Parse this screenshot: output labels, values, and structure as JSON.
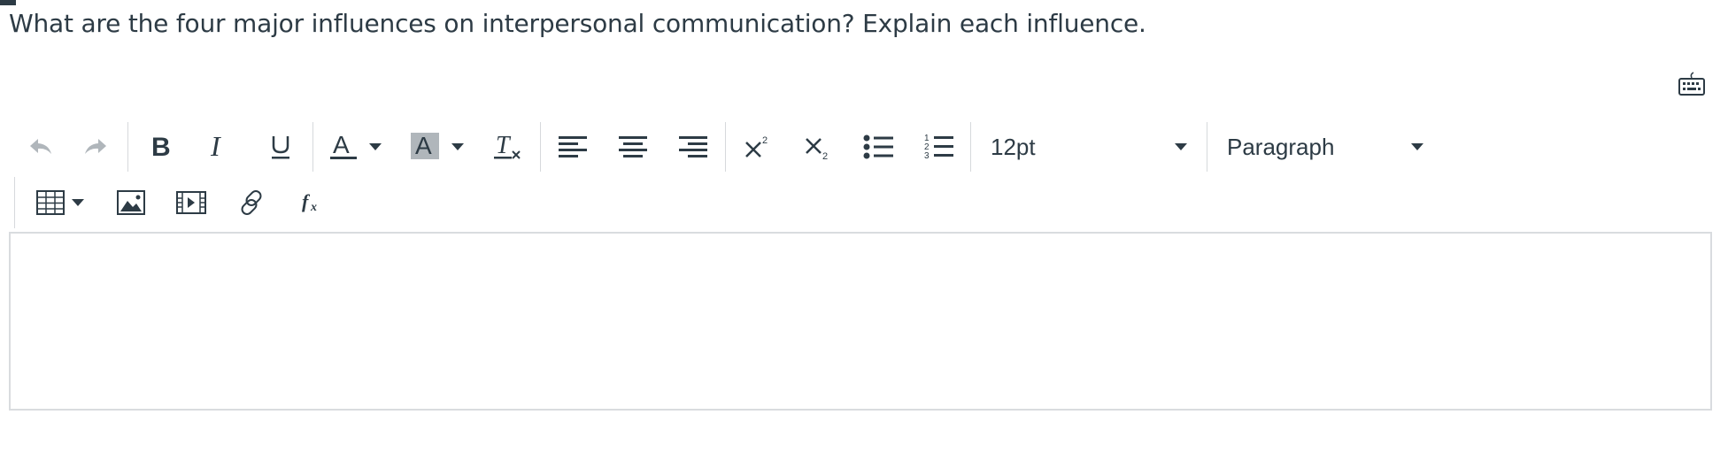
{
  "question": {
    "text": "What are the four major influences on interpersonal communication? Explain each influence."
  },
  "toolbar": {
    "font_size": "12pt",
    "block_format": "Paragraph",
    "icons": [
      "undo-icon",
      "redo-icon",
      "bold-icon",
      "italic-icon",
      "underline-icon",
      "text-color-icon",
      "highlight-color-icon",
      "clear-formatting-icon",
      "align-left-icon",
      "align-center-icon",
      "align-right-icon",
      "superscript-icon",
      "subscript-icon",
      "bullet-list-icon",
      "numbered-list-icon",
      "table-icon",
      "image-icon",
      "media-icon",
      "link-icon",
      "math-icon",
      "keyboard-icon"
    ]
  },
  "editor": {
    "content": ""
  },
  "colors": {
    "text": "#2d3b45",
    "disabled": "#b0b6bb",
    "border": "#d9dcdf"
  }
}
